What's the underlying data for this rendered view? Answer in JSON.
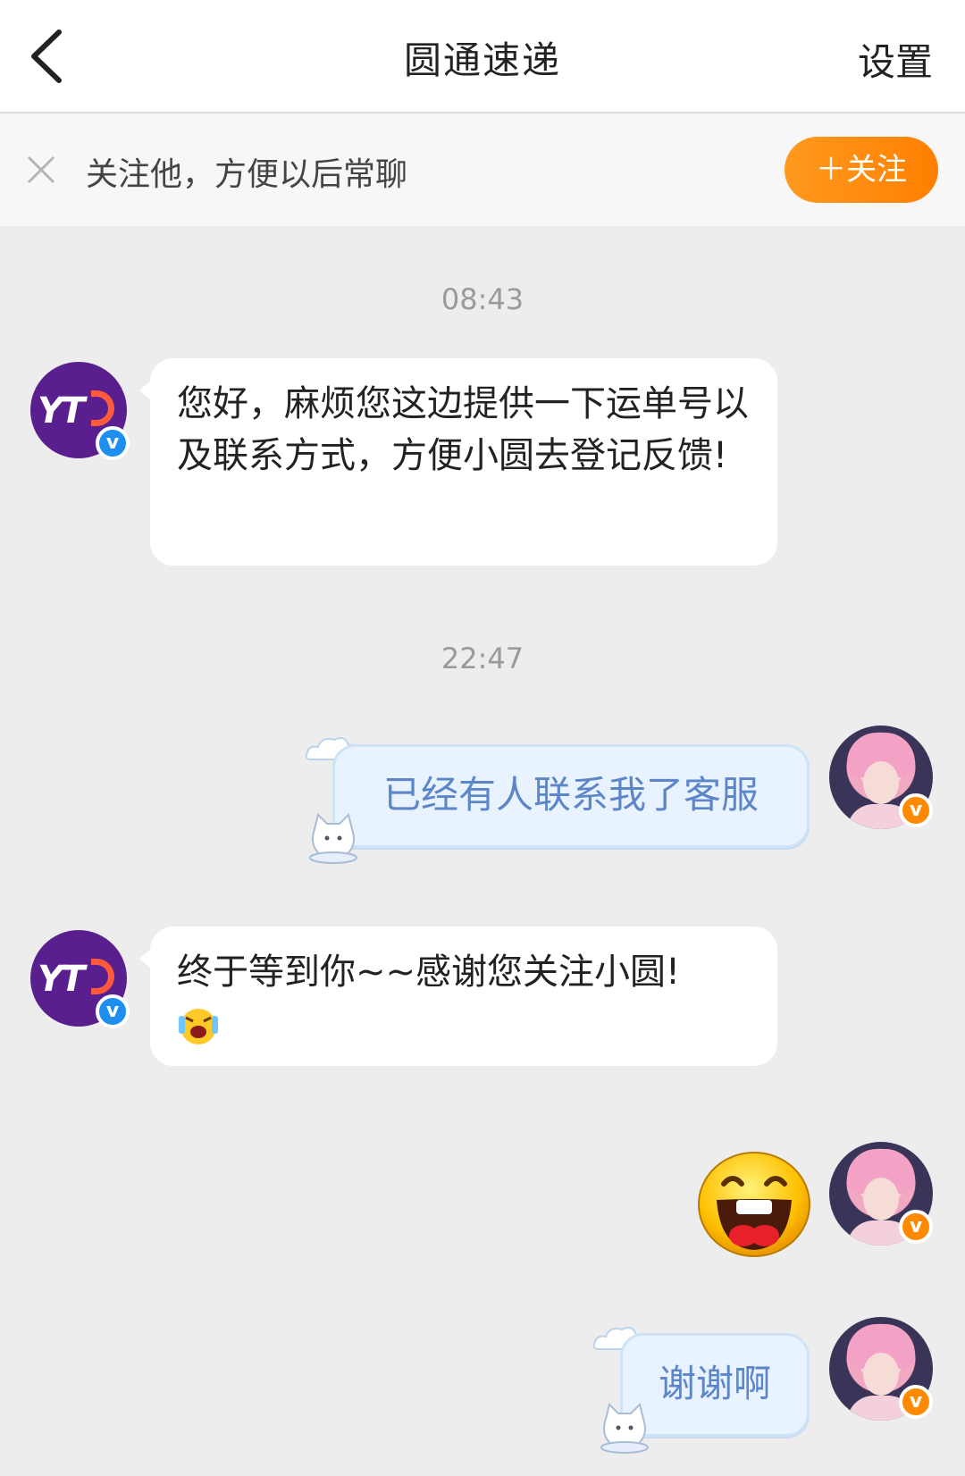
{
  "header": {
    "title": "圆通速递",
    "settings_label": "设置"
  },
  "follow_bar": {
    "prompt_text": "关注他，方便以后常聊",
    "follow_button_label": "＋关注"
  },
  "messages": [
    {
      "type": "timestamp",
      "text": "08:43"
    },
    {
      "type": "incoming",
      "sender": "圆通速递",
      "text": " 您好，麻烦您这边提供一下运单号以及联系方式，方便小圆去登记反馈!"
    },
    {
      "type": "timestamp",
      "text": "22:47"
    },
    {
      "type": "outgoing",
      "text": "已经有人联系我了客服"
    },
    {
      "type": "incoming",
      "sender": "圆通速递",
      "text": "终于等到你~~感谢您关注小圆!"
    },
    {
      "type": "outgoing_sticker",
      "sticker": "laughing-face-emoji"
    },
    {
      "type": "outgoing",
      "text": "谢谢啊"
    }
  ],
  "avatars": {
    "sender_logo_text": "YT",
    "verified_badge_glyph": "v"
  },
  "colors": {
    "accent_orange": "#ff8a00",
    "verified_blue": "#1f8ef1",
    "outgoing_bubble": "#e8f3ff",
    "outgoing_text": "#5d86c8",
    "chat_background": "#ededed"
  }
}
